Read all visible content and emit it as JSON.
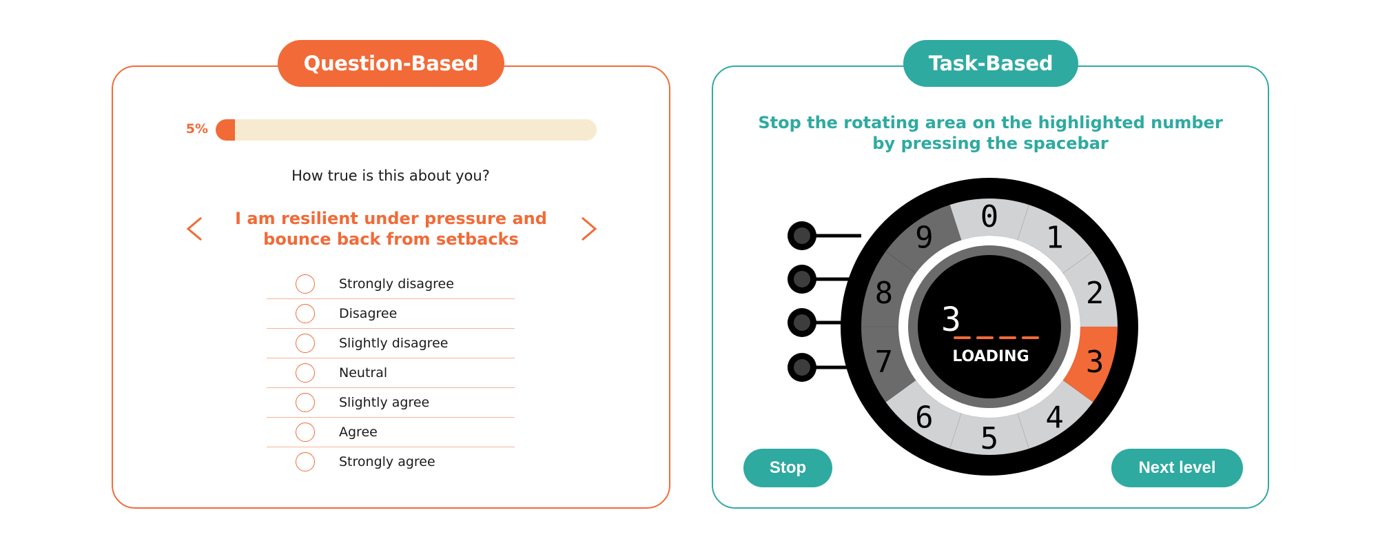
{
  "question_panel": {
    "title": "Question-Based",
    "accent": "#f26a37",
    "progress": {
      "label": "5%",
      "value_percent": 5
    },
    "prompt": "How true is this about you?",
    "statement": "I am resilient under pressure and bounce back from setbacks",
    "nav": {
      "prev_icon": "chevron-left-icon",
      "next_icon": "chevron-right-icon"
    },
    "options": [
      {
        "label": "Strongly disagree",
        "selected": false
      },
      {
        "label": "Disagree",
        "selected": false
      },
      {
        "label": "Slightly disagree",
        "selected": false
      },
      {
        "label": "Neutral",
        "selected": false
      },
      {
        "label": "Slightly agree",
        "selected": false
      },
      {
        "label": "Agree",
        "selected": false
      },
      {
        "label": "Strongly agree",
        "selected": false
      }
    ]
  },
  "task_panel": {
    "title": "Task-Based",
    "accent": "#2eaaa1",
    "instruction": "Stop the rotating area on the highlighted number by pressing the spacebar",
    "dial": {
      "numbers": [
        "0",
        "1",
        "2",
        "3",
        "4",
        "5",
        "6",
        "7",
        "8",
        "9"
      ],
      "highlighted_number": "3",
      "rotating_area_numbers": [
        "7",
        "8",
        "9"
      ],
      "display_digit": "3",
      "display_dashes": 4,
      "display_status": "LOADING",
      "knob_count": 4,
      "colors": {
        "segment": "#d1d2d4",
        "rotating": "#6b6b6b",
        "highlight": "#f26a37",
        "rim": "#000000",
        "knob_inner": "#3d3d3d"
      }
    },
    "buttons": {
      "stop": "Stop",
      "next": "Next level"
    }
  }
}
